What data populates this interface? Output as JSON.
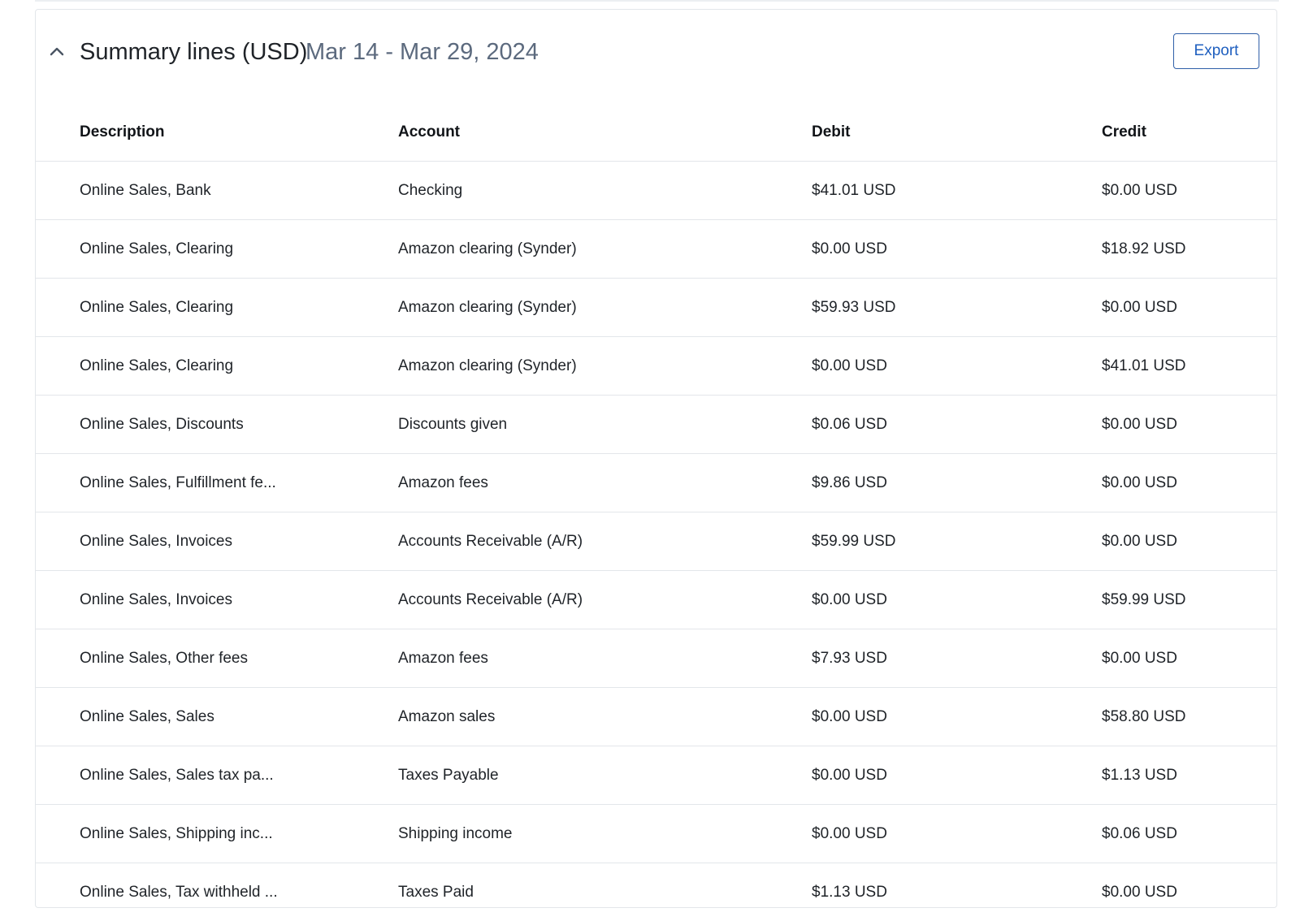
{
  "section": {
    "title": "Summary lines (USD)",
    "date_range": "Mar 14 - Mar 29, 2024",
    "export_label": "Export"
  },
  "table": {
    "columns": {
      "description": "Description",
      "account": "Account",
      "debit": "Debit",
      "credit": "Credit"
    },
    "rows": [
      {
        "description": "Online Sales, Bank",
        "account": "Checking",
        "debit": "$41.01 USD",
        "credit": "$0.00 USD"
      },
      {
        "description": "Online Sales, Clearing",
        "account": "Amazon clearing (Synder)",
        "debit": "$0.00 USD",
        "credit": "$18.92 USD"
      },
      {
        "description": "Online Sales, Clearing",
        "account": "Amazon clearing (Synder)",
        "debit": "$59.93 USD",
        "credit": "$0.00 USD"
      },
      {
        "description": "Online Sales, Clearing",
        "account": "Amazon clearing (Synder)",
        "debit": "$0.00 USD",
        "credit": "$41.01 USD"
      },
      {
        "description": "Online Sales, Discounts",
        "account": "Discounts given",
        "debit": "$0.06 USD",
        "credit": "$0.00 USD"
      },
      {
        "description": "Online Sales, Fulfillment fe...",
        "account": "Amazon fees",
        "debit": "$9.86 USD",
        "credit": "$0.00 USD"
      },
      {
        "description": "Online Sales, Invoices",
        "account": "Accounts Receivable (A/R)",
        "debit": "$59.99 USD",
        "credit": "$0.00 USD"
      },
      {
        "description": "Online Sales, Invoices",
        "account": "Accounts Receivable (A/R)",
        "debit": "$0.00 USD",
        "credit": "$59.99 USD"
      },
      {
        "description": "Online Sales, Other fees",
        "account": "Amazon fees",
        "debit": "$7.93 USD",
        "credit": "$0.00 USD"
      },
      {
        "description": "Online Sales, Sales",
        "account": "Amazon sales",
        "debit": "$0.00 USD",
        "credit": "$58.80 USD"
      },
      {
        "description": "Online Sales, Sales tax pa...",
        "account": "Taxes Payable",
        "debit": "$0.00 USD",
        "credit": "$1.13 USD"
      },
      {
        "description": "Online Sales, Shipping inc...",
        "account": "Shipping income",
        "debit": "$0.00 USD",
        "credit": "$0.06 USD"
      },
      {
        "description": "Online Sales, Tax withheld ...",
        "account": "Taxes Paid",
        "debit": "$1.13 USD",
        "credit": "$0.00 USD"
      }
    ]
  },
  "icons": {
    "collapse": "chevron-up-icon"
  },
  "colors": {
    "accent": "#1f5fbf",
    "zero_amount": "#b3bac4",
    "date_range": "#5c6a7e"
  }
}
